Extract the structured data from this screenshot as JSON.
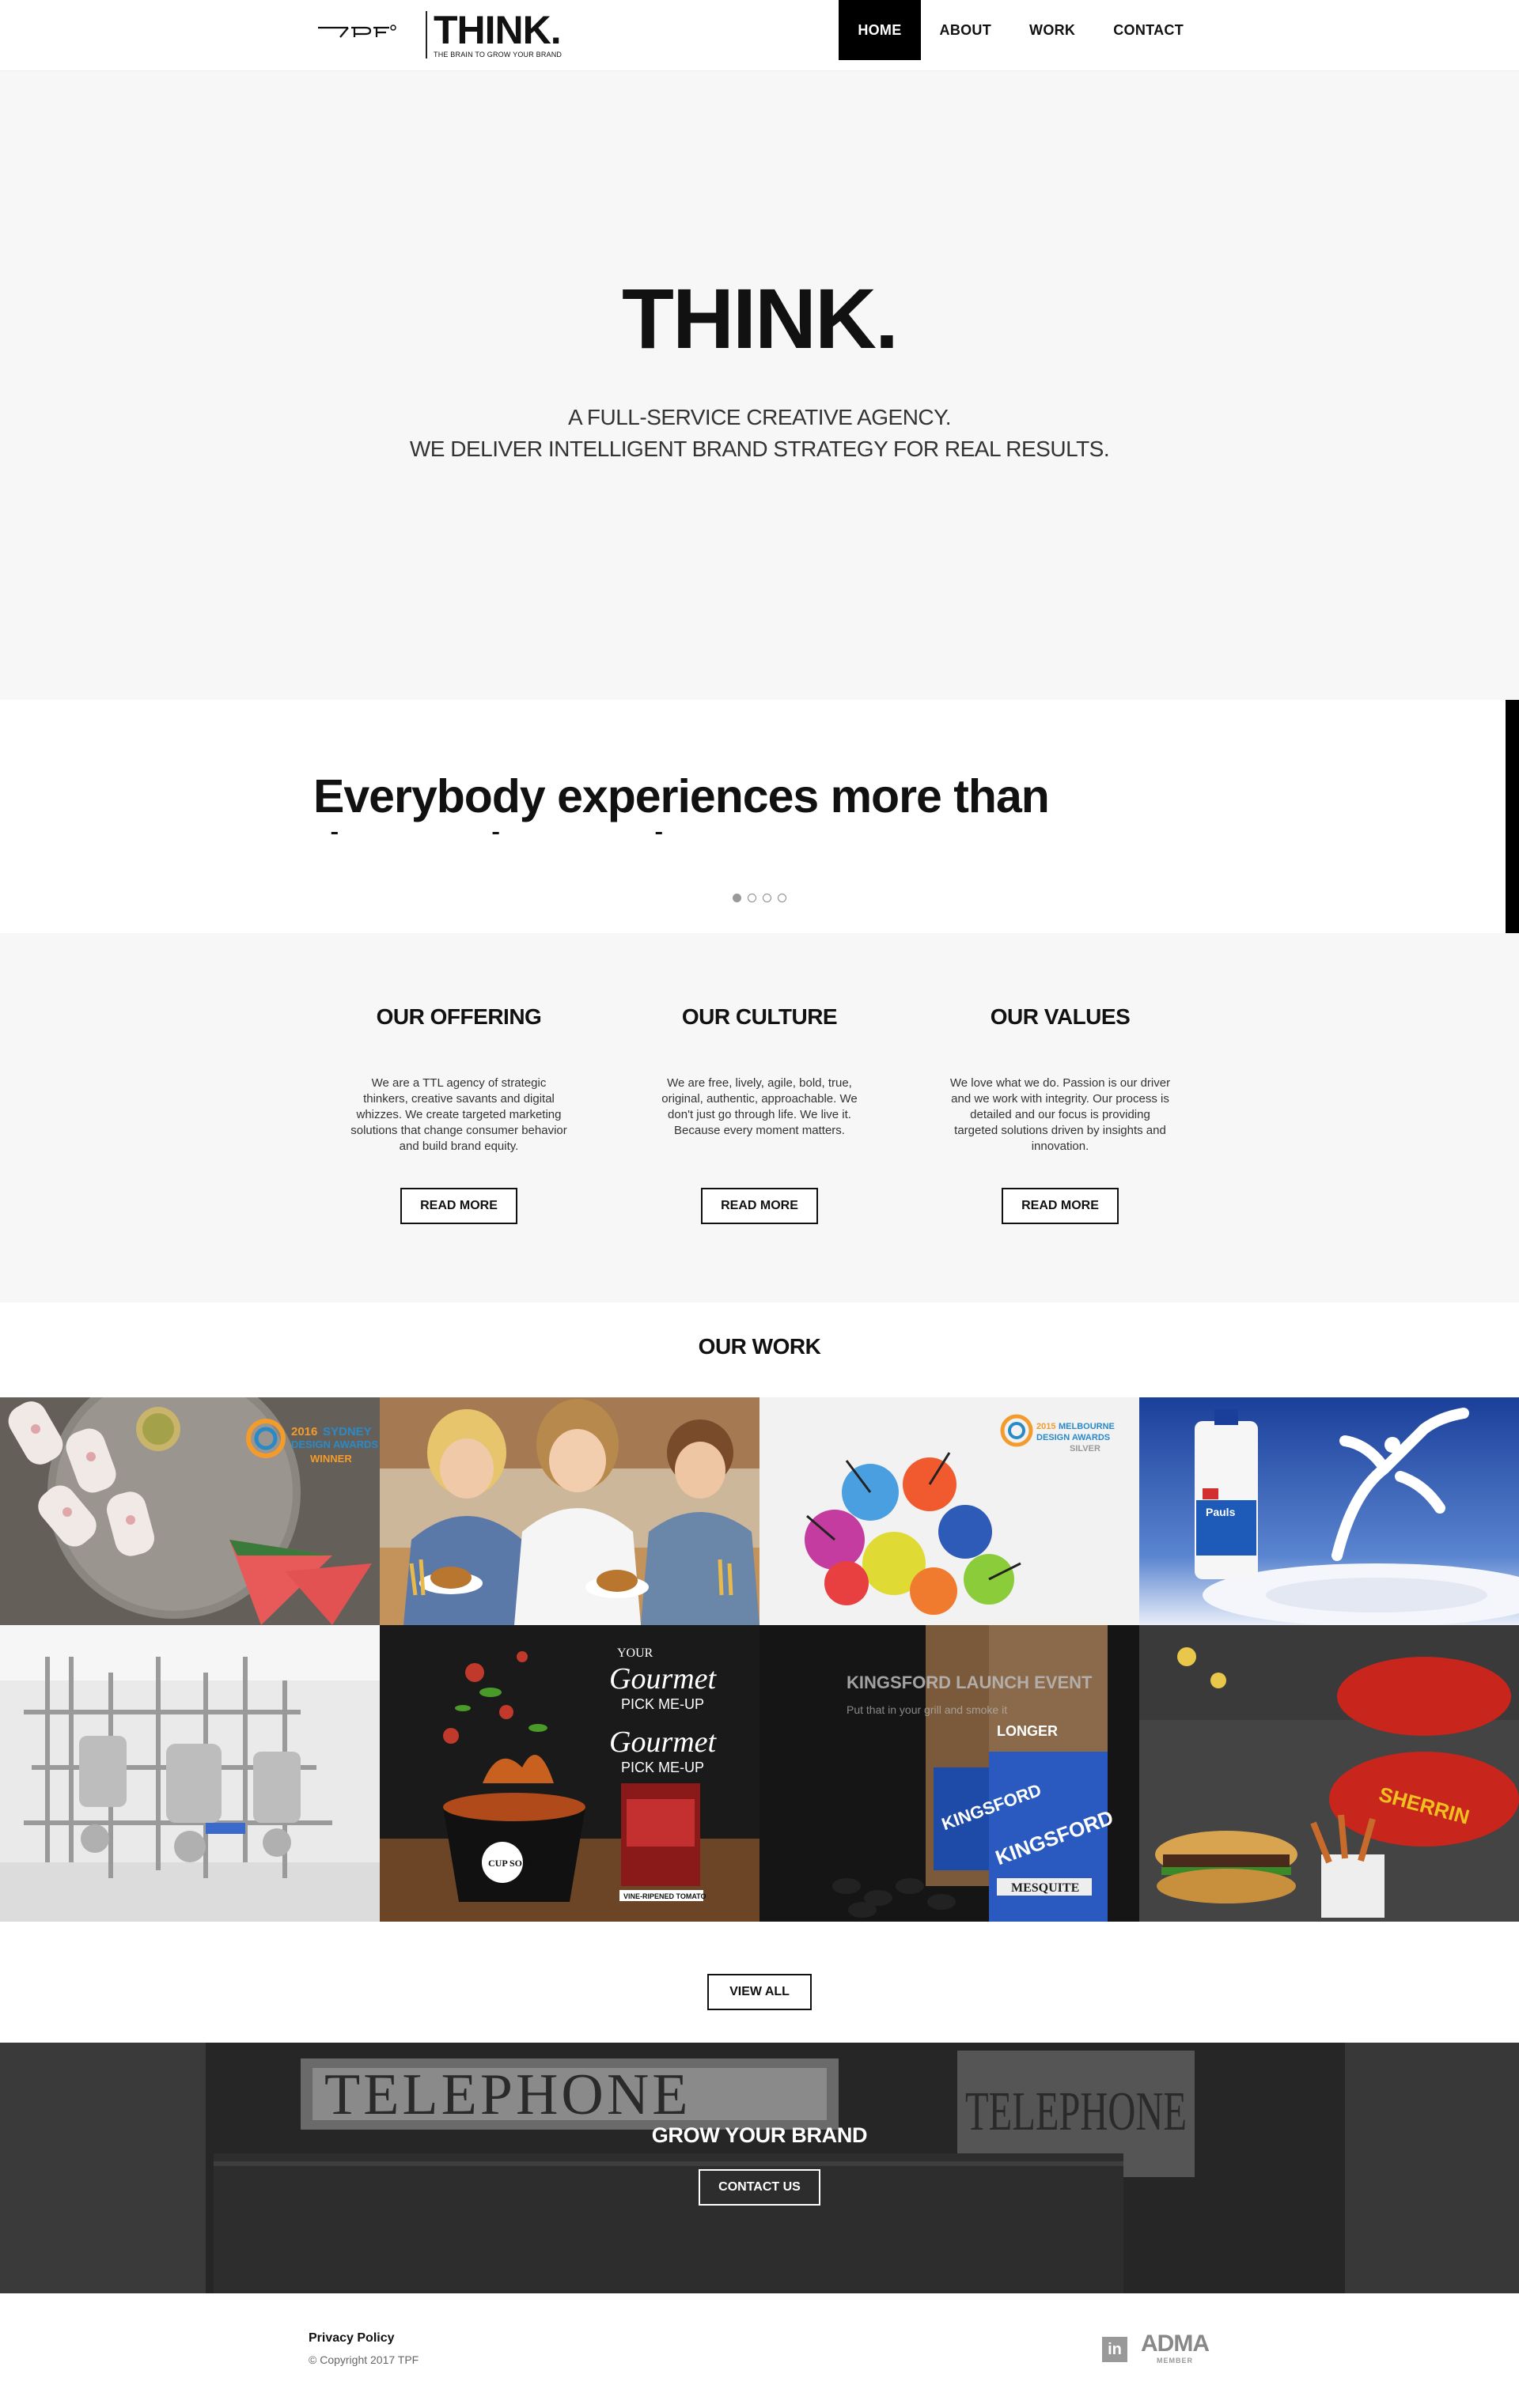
{
  "header": {
    "logo_think": "THINK.",
    "logo_tagline": "THE BRAIN TO GROW YOUR BRAND",
    "nav": [
      "HOME",
      "ABOUT",
      "WORK",
      "CONTACT"
    ],
    "active_nav": "HOME"
  },
  "hero": {
    "title": "THINK.",
    "line1": "A FULL-SERVICE CREATIVE AGENCY.",
    "line2": "WE DELIVER INTELLIGENT BRAND STRATEGY FOR REAL RESULTS."
  },
  "quote": {
    "text": "Everybody experiences more than they understand",
    "slides": 4,
    "active_slide": 1
  },
  "offering": {
    "columns": [
      {
        "title": "OUR OFFERING",
        "body": "We are a TTL agency of strategic thinkers, creative savants and digital whizzes. We create targeted marketing solutions that change consumer behavior and build brand equity.",
        "button": "READ MORE"
      },
      {
        "title": "OUR CULTURE",
        "body": "We are free, lively, agile, bold, true, original, authentic, approachable. We don't just go through life. We live it. Because every moment matters.",
        "button": "READ MORE"
      },
      {
        "title": "OUR VALUES",
        "body": "We love what we do. Passion is our driver and we work with integrity. Our process is detailed and our focus is providing targeted solutions driven by insights and innovation.",
        "button": "READ MORE"
      }
    ]
  },
  "work": {
    "title": "OUR WORK",
    "tiles": [
      {
        "award_year": "2016",
        "award_line1": "SYDNEY",
        "award_line2": "DESIGN AWARDS",
        "award_level": "WINNER"
      },
      {},
      {
        "award_year": "2015",
        "award_line1": "MELBOURNE",
        "award_line2": "DESIGN AWARDS",
        "award_level": "SILVER"
      },
      {
        "brand": "Pauls"
      },
      {},
      {
        "line1": "YOUR",
        "line2": "Gourmet",
        "line3": "PICK ME-UP",
        "brand": "CUP SOUP",
        "tagline": "VINE-RIPENED TOMATO"
      },
      {
        "overlay_title": "KINGSFORD LAUNCH EVENT",
        "overlay_sub": "Put that in your grill and smoke it",
        "brand": "KINGSFORD",
        "bag_label": "LONGER",
        "bag_flavour": "MESQUITE"
      },
      {
        "brand": "SHERRIN"
      }
    ],
    "view_all": "VIEW ALL"
  },
  "cta": {
    "bg_word": "TELEPHONE",
    "title": "GROW YOUR BRAND",
    "button": "CONTACT US"
  },
  "footer": {
    "privacy": "Privacy Policy",
    "copyright": "© Copyright 2017 TPF",
    "linkedin": "in",
    "adma": "ADMA",
    "adma_member": "MEMBER"
  }
}
